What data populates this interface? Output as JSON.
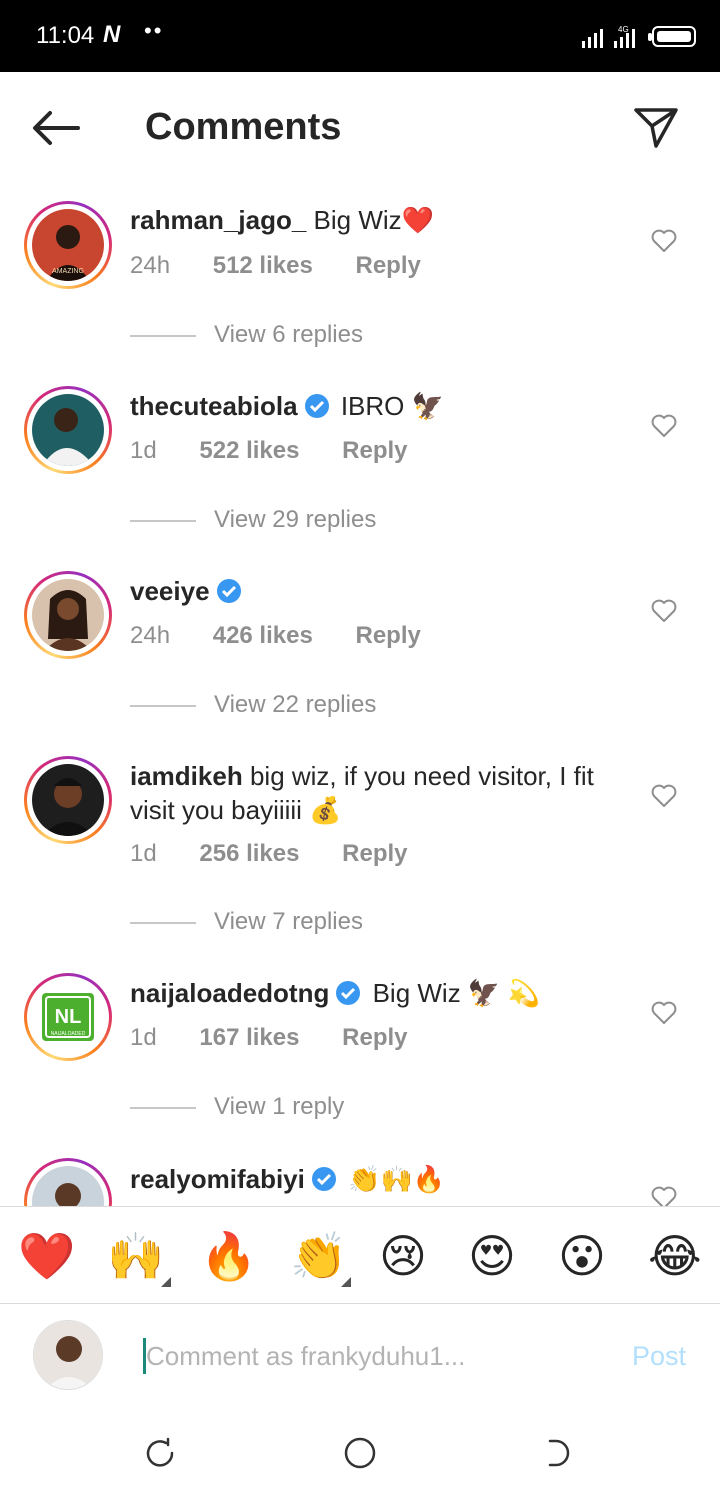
{
  "status_bar": {
    "time": "11:04",
    "carrier_icon": "N",
    "dots": "••",
    "network_label": "4G"
  },
  "header": {
    "title": "Comments",
    "back_icon": "arrow-left-icon",
    "share_icon": "paper-plane-icon"
  },
  "comments": [
    {
      "username": "rahman_jago_",
      "verified": false,
      "text": "Big Wiz❤️",
      "time": "24h",
      "likes": "512 likes",
      "reply": "Reply",
      "view_replies": "View 6 replies",
      "avatar_caption": "AMAZING",
      "avatar_color": "#c0392b"
    },
    {
      "username": "thecuteabiola",
      "verified": true,
      "text": "IBRO 🦅",
      "text_prefix": "IBRO",
      "text_emoji": "🦅",
      "time": "1d",
      "likes": "522 likes",
      "reply": "Reply",
      "view_replies": "View 29 replies",
      "avatar_color": "#1f5f63"
    },
    {
      "username": "veeiye",
      "verified": true,
      "text": "",
      "time": "24h",
      "likes": "426 likes",
      "reply": "Reply",
      "view_replies": "View 22 replies",
      "avatar_color": "#c7a58a"
    },
    {
      "username": "iamdikeh",
      "verified": false,
      "text": "big wiz, if you need visitor, I fit visit you bayiiiii 💰",
      "time": "1d",
      "likes": "256 likes",
      "reply": "Reply",
      "view_replies": "View 7 replies",
      "avatar_color": "#2b2b2b"
    },
    {
      "username": "naijaloadedotng",
      "verified": true,
      "text": "Big Wiz 🦅 💫",
      "time": "1d",
      "likes": "167 likes",
      "reply": "Reply",
      "view_replies": "View 1 reply",
      "avatar_logo": "NL",
      "avatar_logo_sub": "NAIJALOADED",
      "avatar_color": "#4caf2e"
    },
    {
      "username": "realyomifabiyi",
      "verified": true,
      "text": "👏🙌🔥",
      "avatar_color": "#7a8fa8"
    }
  ],
  "emoji_bar": [
    "❤️",
    "🙌",
    "🔥",
    "👏",
    "😢",
    "😍",
    "😮",
    "😂"
  ],
  "composer": {
    "placeholder": "Comment as frankyduhu1...",
    "post_label": "Post"
  },
  "nav": {
    "recents_icon": "recents-icon",
    "home_icon": "home-circle-icon",
    "back_icon": "nav-back-icon"
  },
  "colors": {
    "verified_blue": "#3897f0",
    "post_disabled": "#b2dffc",
    "meta_gray": "#8e8e8e"
  }
}
